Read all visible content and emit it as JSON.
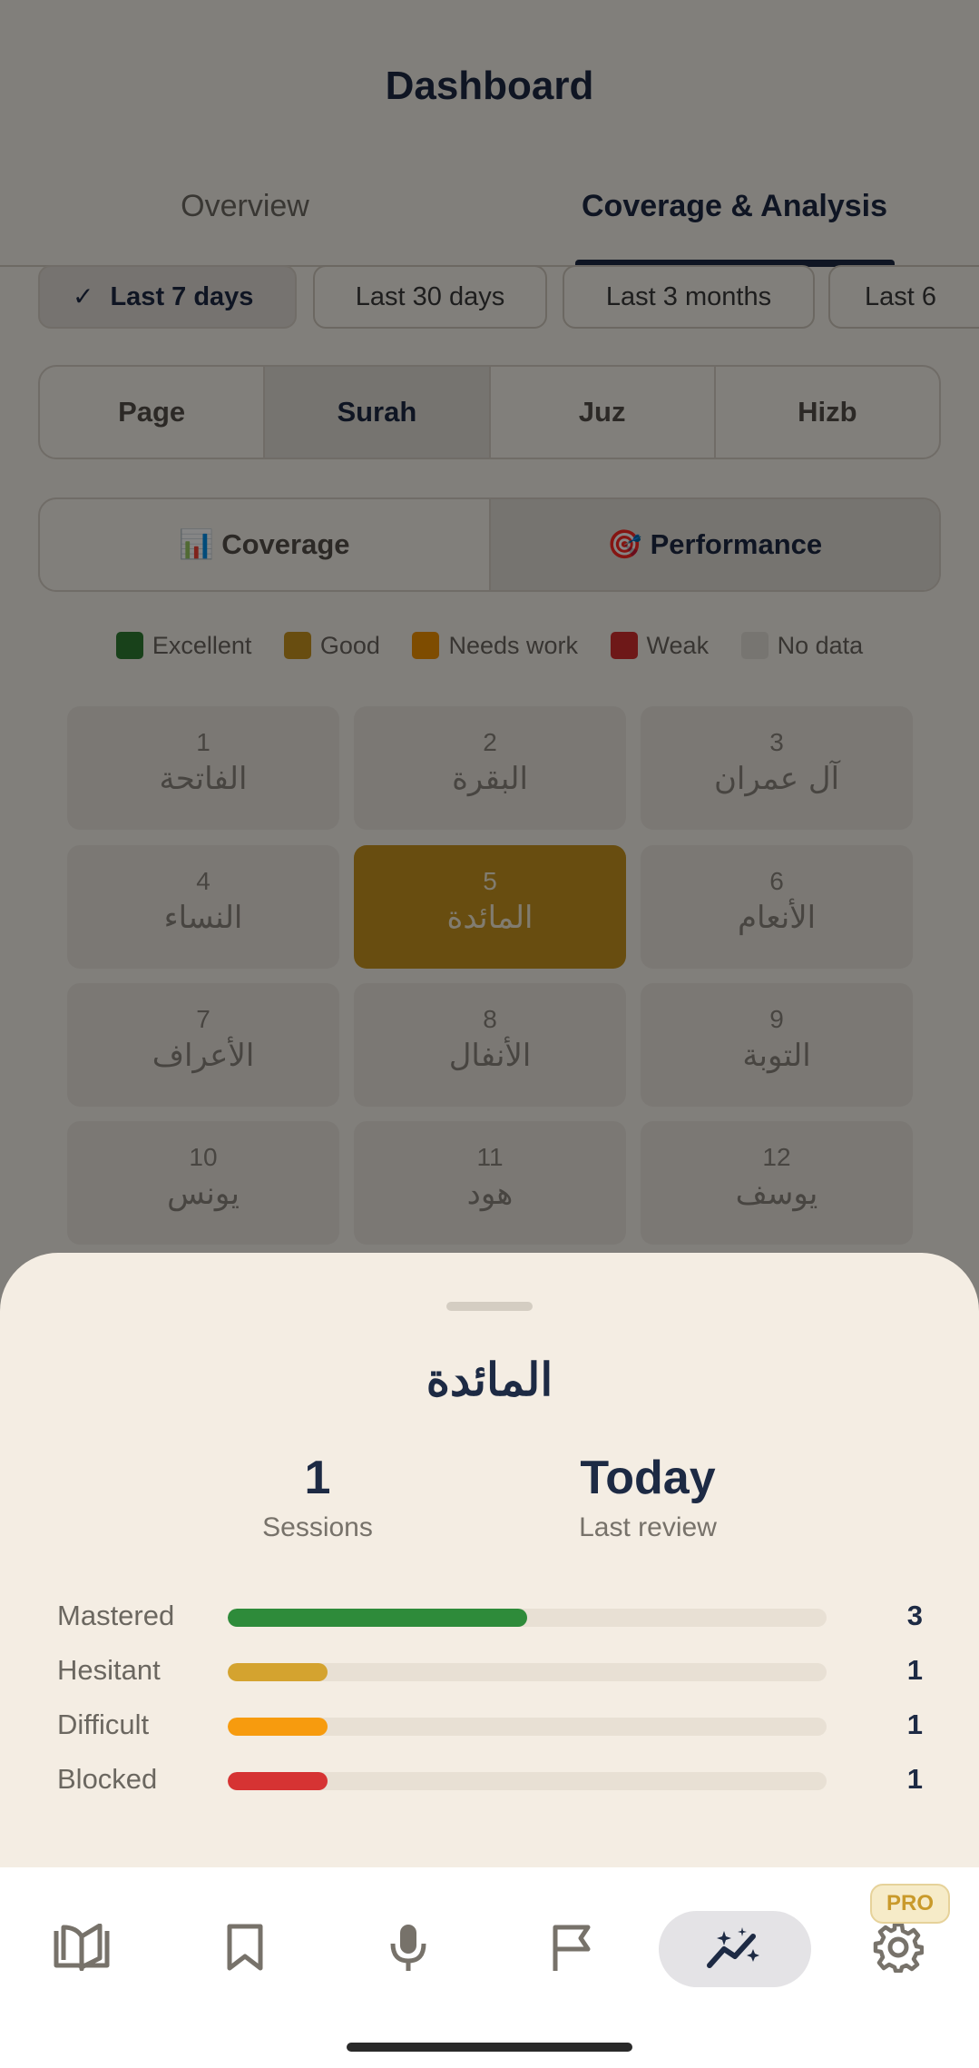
{
  "header": {
    "title": "Dashboard"
  },
  "tabs": [
    {
      "label": "Overview",
      "active": false
    },
    {
      "label": "Coverage & Analysis",
      "active": true
    }
  ],
  "ranges": [
    {
      "label": "Last 7 days",
      "active": true
    },
    {
      "label": "Last 30 days",
      "active": false
    },
    {
      "label": "Last 3 months",
      "active": false
    },
    {
      "label": "Last 6",
      "active": false
    }
  ],
  "unit_selector": [
    {
      "label": "Page",
      "active": false
    },
    {
      "label": "Surah",
      "active": true
    },
    {
      "label": "Juz",
      "active": false
    },
    {
      "label": "Hizb",
      "active": false
    }
  ],
  "view_selector": [
    {
      "label": "📊 Coverage",
      "active": false
    },
    {
      "label": "🎯 Performance",
      "active": true
    }
  ],
  "legend": [
    {
      "label": "Excellent",
      "color": "#2e7d32"
    },
    {
      "label": "Good",
      "color": "#c7941f"
    },
    {
      "label": "Needs work",
      "color": "#f29200"
    },
    {
      "label": "Weak",
      "color": "#d32f2f"
    },
    {
      "label": "No data",
      "color": "#e5e0d9"
    }
  ],
  "surahs": [
    {
      "num": "1",
      "name": "الفاتحة",
      "status": "none"
    },
    {
      "num": "2",
      "name": "البقرة",
      "status": "none"
    },
    {
      "num": "3",
      "name": "آل عمران",
      "status": "none"
    },
    {
      "num": "4",
      "name": "النساء",
      "status": "none"
    },
    {
      "num": "5",
      "name": "المائدة",
      "status": "good"
    },
    {
      "num": "6",
      "name": "الأنعام",
      "status": "none"
    },
    {
      "num": "7",
      "name": "الأعراف",
      "status": "none"
    },
    {
      "num": "8",
      "name": "الأنفال",
      "status": "none"
    },
    {
      "num": "9",
      "name": "التوبة",
      "status": "none"
    },
    {
      "num": "10",
      "name": "يونس",
      "status": "none"
    },
    {
      "num": "11",
      "name": "هود",
      "status": "none"
    },
    {
      "num": "12",
      "name": "يوسف",
      "status": "none"
    }
  ],
  "sheet": {
    "title": "المائدة",
    "sessions_value": "1",
    "sessions_label": "Sessions",
    "review_value": "Today",
    "review_label": "Last review",
    "rows": [
      {
        "label": "Mastered",
        "count": "3",
        "fraction": 0.5,
        "color": "#2e8b3a"
      },
      {
        "label": "Hesitant",
        "count": "1",
        "fraction": 0.167,
        "color": "#d4a32f"
      },
      {
        "label": "Difficult",
        "count": "1",
        "fraction": 0.167,
        "color": "#f79b0e"
      },
      {
        "label": "Blocked",
        "count": "1",
        "fraction": 0.167,
        "color": "#d63333"
      }
    ]
  },
  "nav": {
    "items": [
      {
        "icon": "book-open-icon",
        "active": false
      },
      {
        "icon": "bookmark-icon",
        "active": false
      },
      {
        "icon": "microphone-icon",
        "active": false
      },
      {
        "icon": "flag-icon",
        "active": false
      },
      {
        "icon": "analytics-sparkle-icon",
        "active": true
      },
      {
        "icon": "gear-icon",
        "active": false
      }
    ],
    "pro_badge": "PRO"
  }
}
